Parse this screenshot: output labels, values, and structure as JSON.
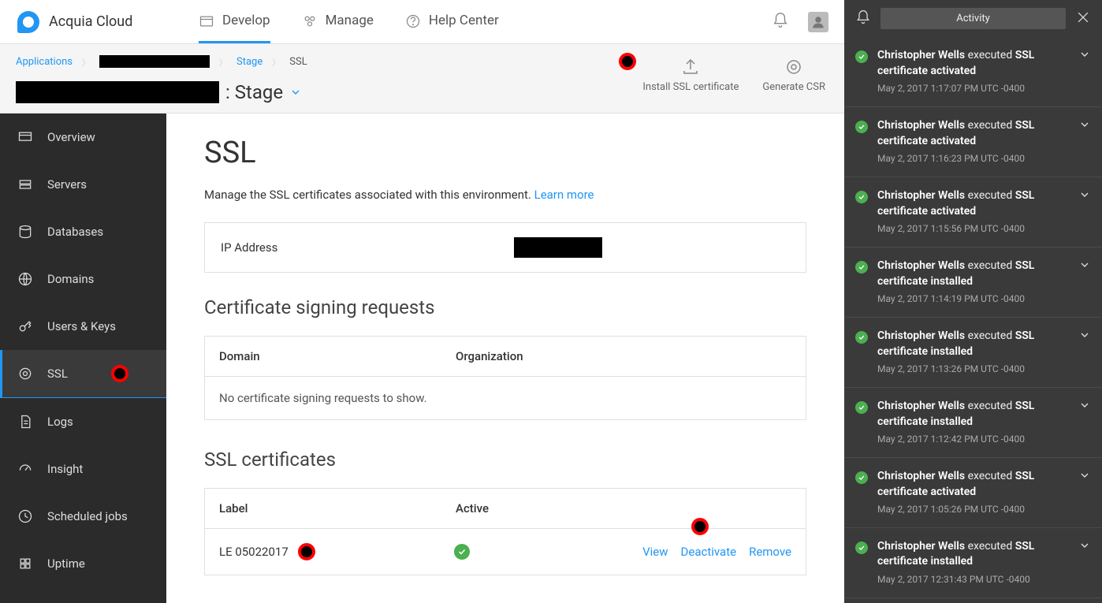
{
  "brand": "Acquia Cloud",
  "topnav": {
    "develop": "Develop",
    "manage": "Manage",
    "help": "Help Center"
  },
  "breadcrumbs": {
    "applications": "Applications",
    "stage": "Stage",
    "ssl": "SSL"
  },
  "env_title_suffix": ": Stage",
  "subheader_actions": {
    "install": "Install SSL certificate",
    "csr": "Generate CSR"
  },
  "sidebar": {
    "overview": "Overview",
    "servers": "Servers",
    "databases": "Databases",
    "domains": "Domains",
    "users": "Users & Keys",
    "ssl": "SSL",
    "logs": "Logs",
    "insight": "Insight",
    "scheduled": "Scheduled jobs",
    "uptime": "Uptime"
  },
  "page": {
    "title": "SSL",
    "desc": "Manage the SSL certificates associated with this environment.",
    "learn_more": "Learn more",
    "ip_label": "IP Address",
    "csr_heading": "Certificate signing requests",
    "csr_cols": {
      "domain": "Domain",
      "org": "Organization"
    },
    "csr_empty": "No certificate signing requests to show.",
    "certs_heading": "SSL certificates",
    "cert_cols": {
      "label": "Label",
      "active": "Active"
    },
    "cert_row": {
      "label": "LE 05022017"
    },
    "cert_actions": {
      "view": "View",
      "deactivate": "Deactivate",
      "remove": "Remove"
    }
  },
  "activity": {
    "button": "Activity",
    "items": [
      {
        "user": "Christopher Wells",
        "verb": "executed",
        "action": "SSL certificate activated",
        "ts": "May 2, 2017 1:17:07 PM UTC -0400"
      },
      {
        "user": "Christopher Wells",
        "verb": "executed",
        "action": "SSL certificate activated",
        "ts": "May 2, 2017 1:16:23 PM UTC -0400"
      },
      {
        "user": "Christopher Wells",
        "verb": "executed",
        "action": "SSL certificate activated",
        "ts": "May 2, 2017 1:15:56 PM UTC -0400"
      },
      {
        "user": "Christopher Wells",
        "verb": "executed",
        "action": "SSL certificate installed",
        "ts": "May 2, 2017 1:14:19 PM UTC -0400"
      },
      {
        "user": "Christopher Wells",
        "verb": "executed",
        "action": "SSL certificate installed",
        "ts": "May 2, 2017 1:13:26 PM UTC -0400"
      },
      {
        "user": "Christopher Wells",
        "verb": "executed",
        "action": "SSL certificate installed",
        "ts": "May 2, 2017 1:12:42 PM UTC -0400"
      },
      {
        "user": "Christopher Wells",
        "verb": "executed",
        "action": "SSL certificate activated",
        "ts": "May 2, 2017 1:05:26 PM UTC -0400"
      },
      {
        "user": "Christopher Wells",
        "verb": "executed",
        "action": "SSL certificate installed",
        "ts": "May 2, 2017 12:31:43 PM UTC -0400"
      }
    ]
  }
}
